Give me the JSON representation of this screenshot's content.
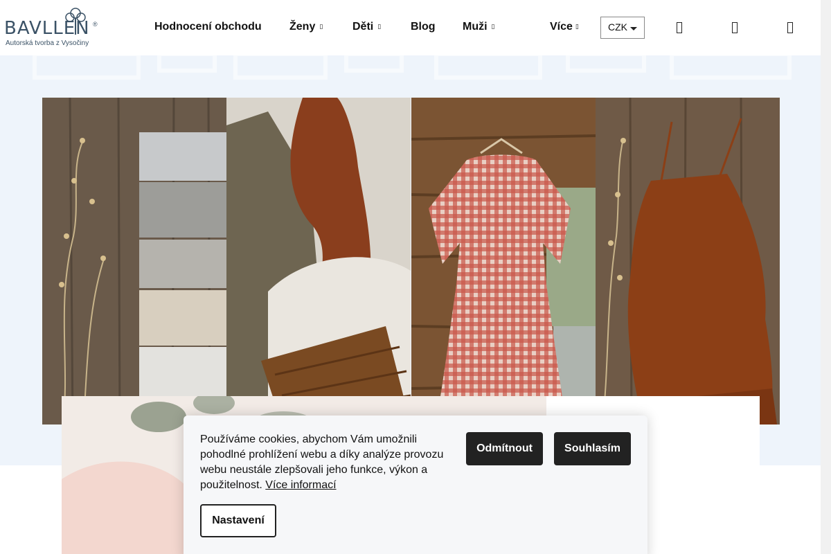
{
  "logo": {
    "brand": "BAVLLEN",
    "registered": "®",
    "tagline": "Autorská tvorba z Vysočiny"
  },
  "nav": {
    "items": [
      {
        "label": "Hodnocení obchodu",
        "has_dropdown": false
      },
      {
        "label": "Ženy",
        "has_dropdown": true
      },
      {
        "label": "Děti",
        "has_dropdown": true
      },
      {
        "label": "Blog",
        "has_dropdown": false
      },
      {
        "label": "Muži",
        "has_dropdown": true
      },
      {
        "label": "Více",
        "has_dropdown": true
      }
    ],
    "caret": "▯"
  },
  "currency": {
    "selected": "CZK"
  },
  "header_icons": [
    "search-icon",
    "account-icon",
    "cart-icon"
  ],
  "banner": {
    "panels": [
      "fabric-rolls",
      "woman-laundry-basket",
      "gingham-dress",
      "rust-linen-romper"
    ]
  },
  "cookie": {
    "text": "Používáme cookies, abychom Vám umožnili pohodlné prohlížení webu a díky analýze provozu webu neustále zlepšovali jeho funkce, výkon a použitelnost.",
    "more_link": "Více informací",
    "reject_label": "Odmítnout",
    "accept_label": "Souhlasím",
    "settings_label": "Nastavení"
  },
  "colors": {
    "brand": "#3b5266",
    "banner_bg": "#eef4fb",
    "button_dark": "#222222"
  }
}
